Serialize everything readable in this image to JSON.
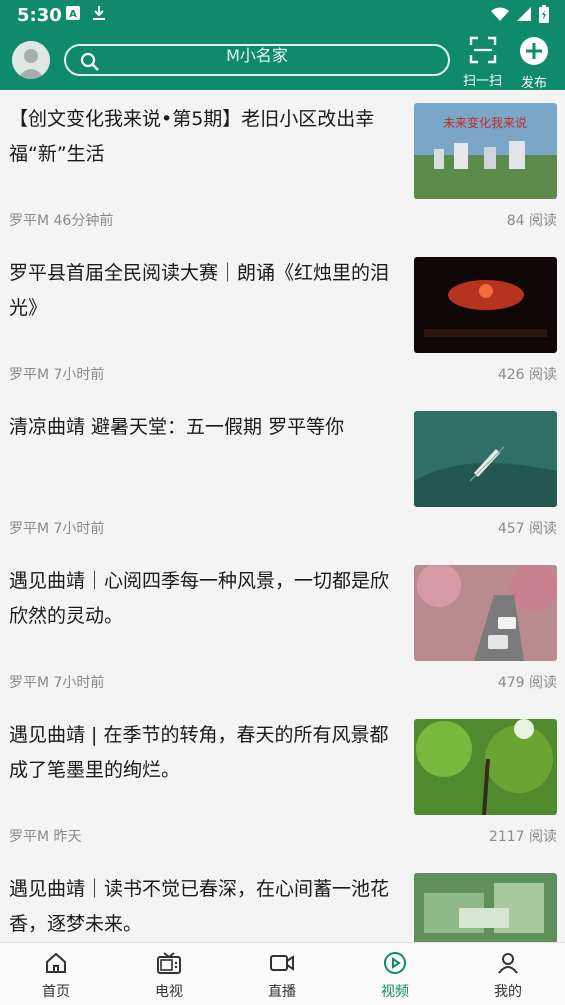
{
  "status_bar": {
    "time": "5:30",
    "icons": [
      "a-box-icon",
      "download-icon",
      "wifi-icon",
      "signal-icon",
      "battery-icon"
    ]
  },
  "header": {
    "search_text": "M小名家",
    "scan_label": "扫一扫",
    "publish_label": "发布"
  },
  "feed": [
    {
      "title": "【创文变化我来说•第5期】老旧小区改出幸福“新”生活",
      "source_time": "罗平M 46分钟前",
      "reads": "84 阅读",
      "thumb_text": "未来变化我来说"
    },
    {
      "title": "罗平县首届全民阅读大赛｜朗诵《红烛里的泪光》",
      "source_time": "罗平M 7小时前",
      "reads": "426 阅读",
      "thumb_text": ""
    },
    {
      "title": "清凉曲靖 避暑天堂：五一假期 罗平等你",
      "source_time": "罗平M 7小时前",
      "reads": "457 阅读",
      "thumb_text": ""
    },
    {
      "title": "遇见曲靖｜心阅四季每一种风景，一切都是欣欣然的灵动。",
      "source_time": "罗平M 7小时前",
      "reads": "479 阅读",
      "thumb_text": ""
    },
    {
      "title": "遇见曲靖 | 在季节的转角，春天的所有风景都成了笔墨里的绚烂。",
      "source_time": "罗平M 昨天",
      "reads": "2117 阅读",
      "thumb_text": ""
    },
    {
      "title": "遇见曲靖｜读书不觉已春深，在心间蓄一池花香，逐梦未来。",
      "source_time": "",
      "reads": "",
      "thumb_text": ""
    }
  ],
  "tabbar": {
    "tabs": [
      {
        "label": "首页"
      },
      {
        "label": "电视"
      },
      {
        "label": "直播"
      },
      {
        "label": "视频"
      },
      {
        "label": "我的"
      }
    ],
    "active_index": 3,
    "accent_color": "#0f8a6a"
  }
}
